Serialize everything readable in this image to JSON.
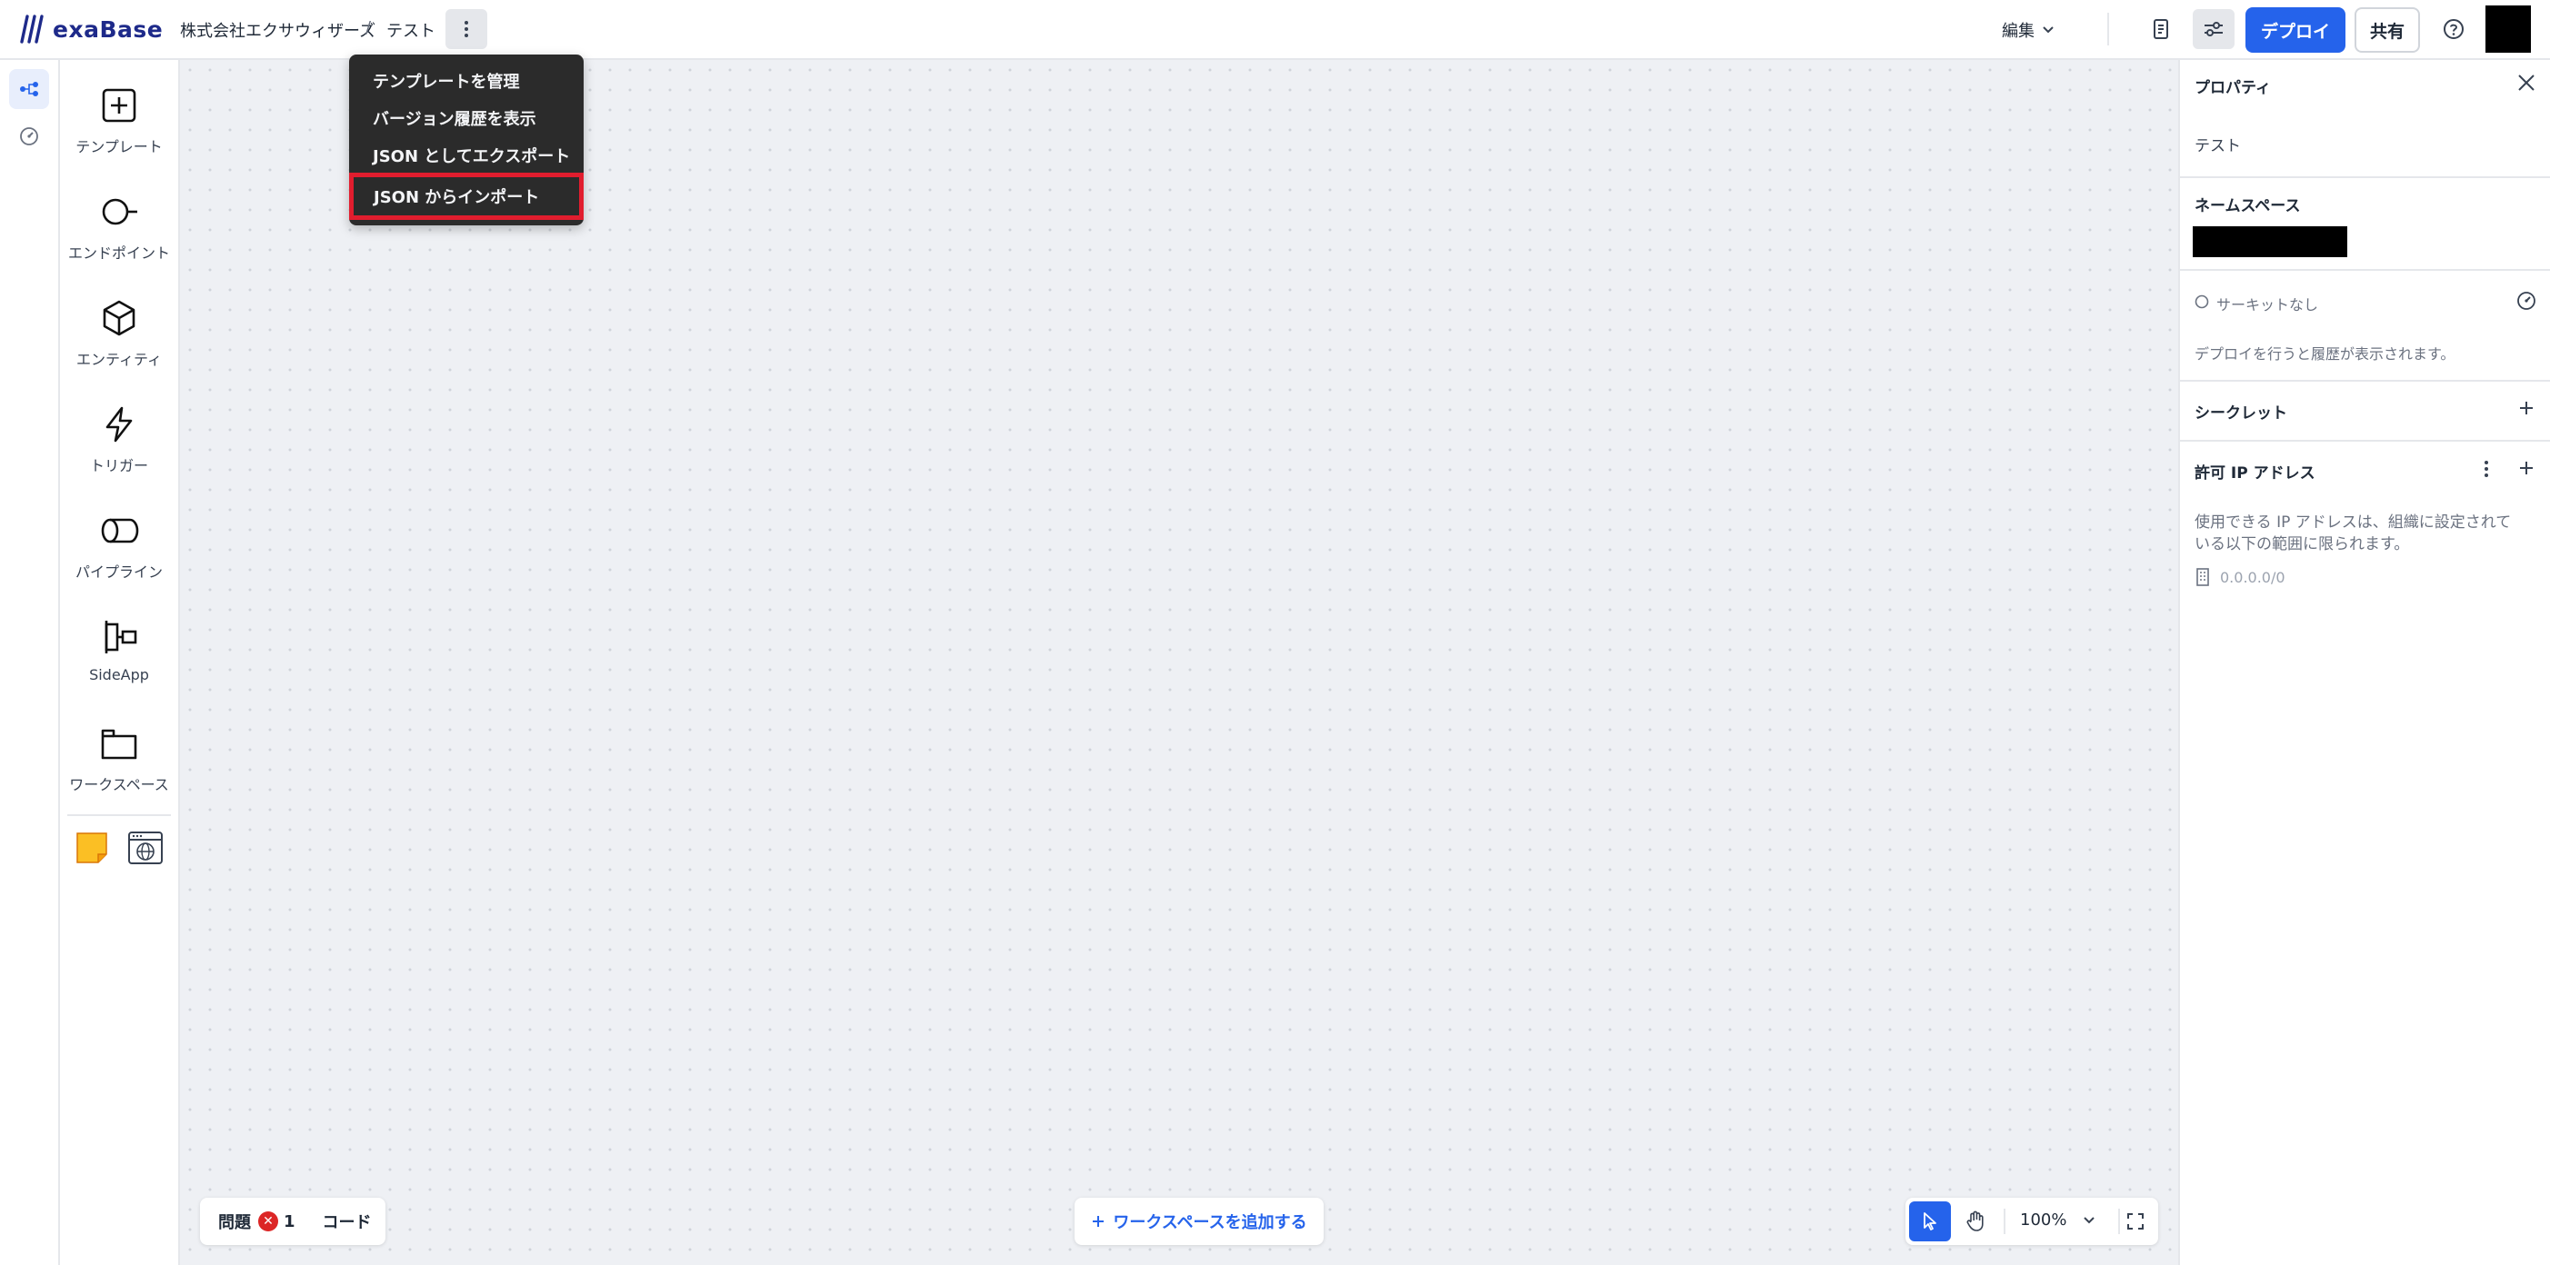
{
  "app": {
    "logo_text": "exaBase",
    "org_name": "株式会社エクサウィザーズ",
    "separator": "/",
    "project_name": "テスト"
  },
  "header": {
    "edit_label": "編集",
    "deploy_label": "デプロイ",
    "share_label": "共有"
  },
  "menu": {
    "items": [
      "テンプレートを管理",
      "バージョン履歴を表示",
      "JSON としてエクスポート",
      "JSON からインポート"
    ]
  },
  "palette": {
    "items": [
      {
        "label": "テンプレート",
        "icon": "plus-square-icon"
      },
      {
        "label": "エンドポイント",
        "icon": "endpoint-icon"
      },
      {
        "label": "エンティティ",
        "icon": "cube-icon"
      },
      {
        "label": "トリガー",
        "icon": "lightning-icon"
      },
      {
        "label": "パイプライン",
        "icon": "cylinder-icon"
      },
      {
        "label": "SideApp",
        "icon": "sideapp-icon"
      },
      {
        "label": "ワークスペース",
        "icon": "folder-icon"
      }
    ]
  },
  "bottom": {
    "issues_label": "問題",
    "issues_count": "1",
    "code_label": "コード",
    "add_workspace_label": "ワークスペースを追加する",
    "zoom_level": "100%"
  },
  "panel": {
    "title": "プロパティ",
    "project_name": "テスト",
    "namespace_title": "ネームスペース",
    "circuit_label": "サーキットなし",
    "deploy_history_text": "デプロイを行うと履歴が表示されます。",
    "secrets_title": "シークレット",
    "allowed_ip_title": "許可 IP アドレス",
    "allowed_ip_desc_line1": "使用できる IP アドレスは、組織に設定されて",
    "allowed_ip_desc_line2": "いる以下の範囲に限られます。",
    "ip_range": "0.0.0.0/0"
  },
  "colors": {
    "accent": "#2563eb",
    "highlight_border": "#e11d2e",
    "menu_bg": "#2b2b2b",
    "error": "#dc2626",
    "sticky_note": "#fbbf24"
  }
}
